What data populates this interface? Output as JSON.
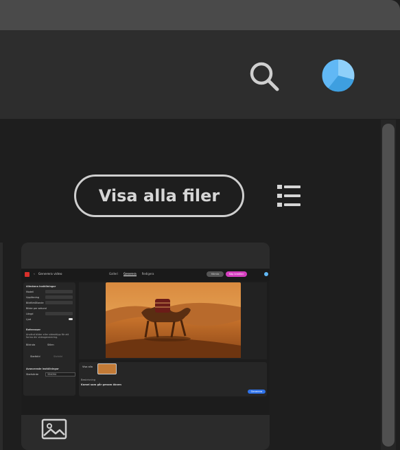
{
  "header": {
    "search_icon": "search-icon",
    "avatar_icon": "avatar-icon"
  },
  "toolbar": {
    "view_all_label": "Visa alla filer",
    "list_view_icon": "list-view-icon"
  },
  "recent_file": {
    "preview": {
      "top_tabs": [
        "Galleri",
        "Generera",
        "Redigera"
      ],
      "active_tab": "Generera",
      "back_label": "Generera video",
      "share_label": "Hämta",
      "upgrade_label": "Köp krediter",
      "panel_sections": [
        "Allmänna inställningar",
        "Referenser",
        "Avancerade inställningar"
      ],
      "panel_rows": [
        "Modell",
        "Upplösning",
        "Bildförhållande",
        "Bilder per sekund",
        "Längd",
        "Ljud"
      ],
      "references_text": "Använd bilder eller videoklipp för att forma din videogenerering.",
      "reference_tabs": [
        "Bildruta",
        "Stilen"
      ],
      "reference_buttons": [
        "Startbild",
        "Slutbild"
      ],
      "seed_label": "Startvärde",
      "seed_value": "334094",
      "prompt_heading": "Beskrivning",
      "prompt_text": "Kamel som går genom öknen",
      "generate_label": "Generera",
      "show_all_label": "Visa alla"
    },
    "footer_icon": "image-icon"
  },
  "colors": {
    "accent_blue": "#2f72e8",
    "upgrade_pink": "#d53fbf",
    "avatar_blue": "#61b8f5"
  }
}
